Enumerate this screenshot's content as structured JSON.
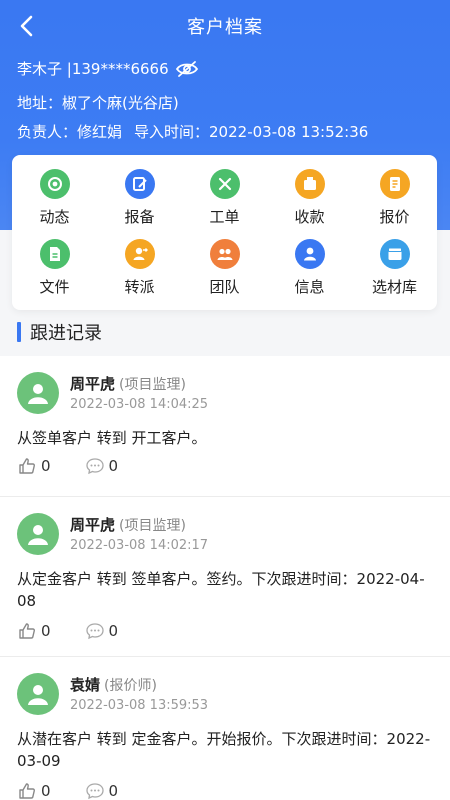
{
  "header": {
    "title": "客户档案",
    "customer": "李木子 |139****6666",
    "address": "地址：椒了个麻(光谷店)",
    "owner": "负责人：修红娟",
    "import_time": "导入时间：2022-03-08 13:52:36"
  },
  "menu": [
    {
      "label": "动态",
      "color": "#4cbf6c"
    },
    {
      "label": "报备",
      "color": "#3a78f2"
    },
    {
      "label": "工单",
      "color": "#4cbf6c"
    },
    {
      "label": "收款",
      "color": "#f5a623"
    },
    {
      "label": "报价",
      "color": "#f5a623"
    },
    {
      "label": "文件",
      "color": "#4cbf6c"
    },
    {
      "label": "转派",
      "color": "#f5a623"
    },
    {
      "label": "团队",
      "color": "#f07f3c"
    },
    {
      "label": "信息",
      "color": "#3a78f2"
    },
    {
      "label": "选材库",
      "color": "#3aa0e8"
    }
  ],
  "section_title": "跟进记录",
  "feed": [
    {
      "name": "周平虎",
      "role": "(项目监理)",
      "time": "2022-03-08 14:04:25",
      "content": "从签单客户 转到 开工客户。",
      "likes": "0",
      "comments": "0"
    },
    {
      "name": "周平虎",
      "role": "(项目监理)",
      "time": "2022-03-08 14:02:17",
      "content": "从定金客户 转到 签单客户。签约。下次跟进时间：2022-04-08",
      "likes": "0",
      "comments": "0"
    },
    {
      "name": "袁婧",
      "role": "(报价师)",
      "time": "2022-03-08 13:59:53",
      "content": "从潜在客户 转到 定金客户。开始报价。下次跟进时间：2022-03-09",
      "likes": "0",
      "comments": "0"
    }
  ]
}
